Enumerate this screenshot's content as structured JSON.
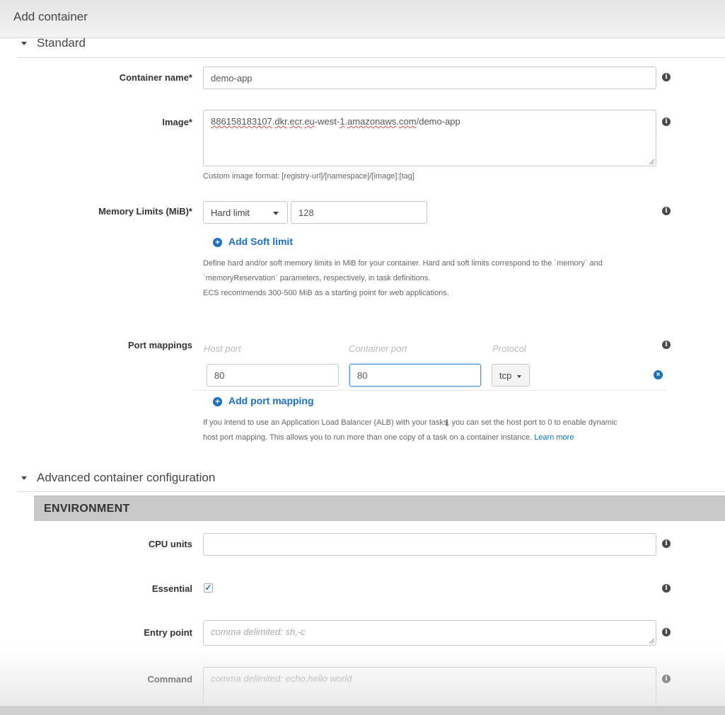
{
  "header": {
    "title": "Add container"
  },
  "sections": {
    "standard": "Standard",
    "advanced": "Advanced container configuration",
    "environment": "ENVIRONMENT"
  },
  "container_name": {
    "label": "Container name*",
    "value": "demo-app"
  },
  "image": {
    "label": "Image*",
    "value_parts": [
      "886158183107",
      ".",
      "dkr",
      ".",
      "ecr",
      ".",
      "eu",
      "-west-",
      "1",
      ".",
      "amazonaws",
      ".",
      "com",
      "/demo-app"
    ],
    "help": "Custom image format: [registry-url]/[namespace]/[image]:[tag]"
  },
  "memory": {
    "label": "Memory Limits (MiB)*",
    "limit_type": "Hard limit",
    "value": "128",
    "add_soft_limit": "Add Soft limit",
    "help_line1": "Define hard and/or soft memory limits in MiB for your container. Hard and soft limits correspond to the `memory` and",
    "help_line2": "`memoryReservation` parameters, respectively, in task definitions.",
    "help_line3": "ECS recommends 300-500 MiB as a starting point for web applications."
  },
  "port_mappings": {
    "label": "Port mappings",
    "col_host": "Host port",
    "col_container": "Container port",
    "col_protocol": "Protocol",
    "rows": [
      {
        "host": "80",
        "container": "80",
        "protocol": "tcp"
      }
    ],
    "add_mapping": "Add port mapping",
    "help_line1": "If you intend to use an Application Load Balancer (ALB) with your tasks, you can set the host port to 0 to enable dynamic",
    "help_line2": "host port mapping. This allows you to run more than one copy of a task on a container instance.",
    "learn_more": "Learn more"
  },
  "environment": {
    "cpu_units": {
      "label": "CPU units",
      "value": ""
    },
    "essential": {
      "label": "Essential",
      "checked": true
    },
    "entry_point": {
      "label": "Entry point",
      "placeholder": "comma delimited: sh,-c"
    },
    "command": {
      "label": "Command",
      "placeholder": "comma delimited: echo,hello world"
    }
  },
  "icons": {
    "info": "info-icon",
    "plus": "plus-circle-icon",
    "remove": "remove-circle-icon",
    "check": "checkmark-icon",
    "caret": "caret-down-icon"
  },
  "colors": {
    "link": "#1a6fbf",
    "env_bar": "#c8c8c8"
  }
}
